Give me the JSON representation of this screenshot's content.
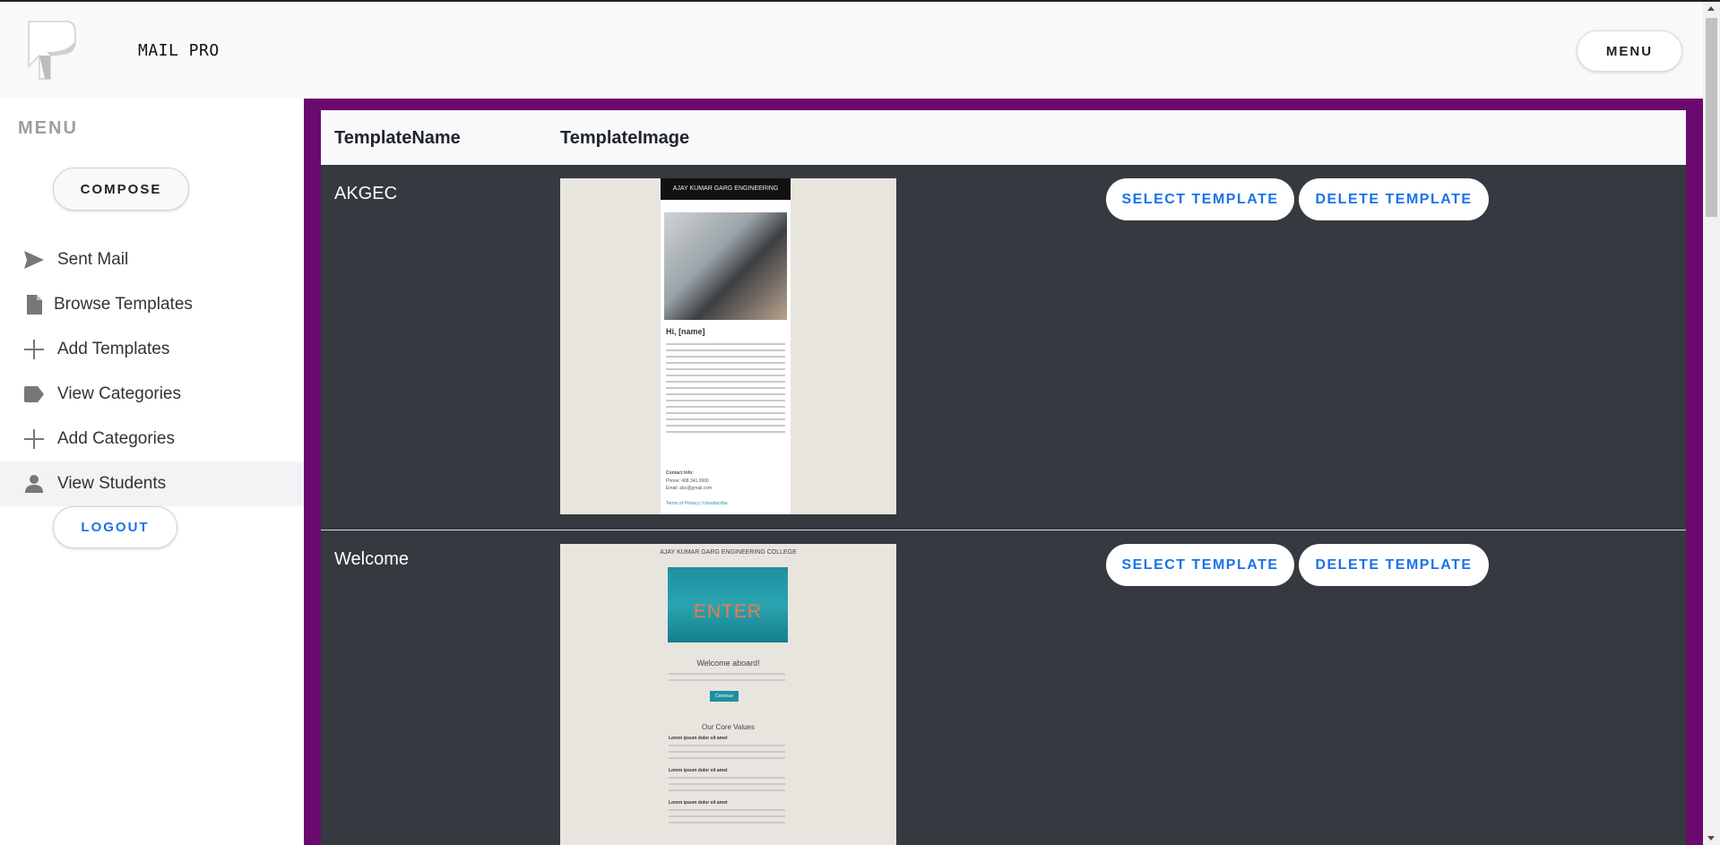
{
  "header": {
    "app_title": "MAIL PRO",
    "menu_label": "MENU"
  },
  "sidebar": {
    "heading": "MENU",
    "compose_label": "COMPOSE",
    "items": [
      {
        "label": "Sent Mail",
        "icon": "send-icon"
      },
      {
        "label": "Browse Templates",
        "icon": "document-icon"
      },
      {
        "label": "Add Templates",
        "icon": "plus-icon"
      },
      {
        "label": "View Categories",
        "icon": "label-icon"
      },
      {
        "label": "Add Categories",
        "icon": "plus-icon"
      },
      {
        "label": "View Students",
        "icon": "person-icon"
      }
    ],
    "active_item": "View Students",
    "logout_label": "LOGOUT"
  },
  "table": {
    "headers": [
      "TemplateName",
      "TemplateImage"
    ],
    "rows": [
      {
        "name": "AKGEC",
        "select_label": "SELECT TEMPLATE",
        "delete_label": "DELETE TEMPLATE",
        "thumbnail": {
          "header": "AJAY KUMAR GARG ENGINEERING COLLEGE",
          "greeting": "Hi, [name]",
          "contact": "Contact Info:",
          "phone": "Phone: 408.341.0600",
          "email": "Email: abc@gmail.com",
          "footer": "Terms of Privacy | Unsubscribe"
        }
      },
      {
        "name": "Welcome",
        "select_label": "SELECT TEMPLATE",
        "delete_label": "DELETE TEMPLATE",
        "thumbnail": {
          "header": "AJAY KUMAR GARG ENGINEERING COLLEGE",
          "photo_text": "ENTER",
          "welcome": "Welcome aboard!",
          "button": "Continue",
          "core_values": "Our Core Values",
          "item": "Lorem ipsum dolor sit amet"
        }
      }
    ]
  },
  "colors": {
    "frame": "#6b0a6e",
    "table_bg": "#343a40",
    "accent": "#1a73e8"
  }
}
